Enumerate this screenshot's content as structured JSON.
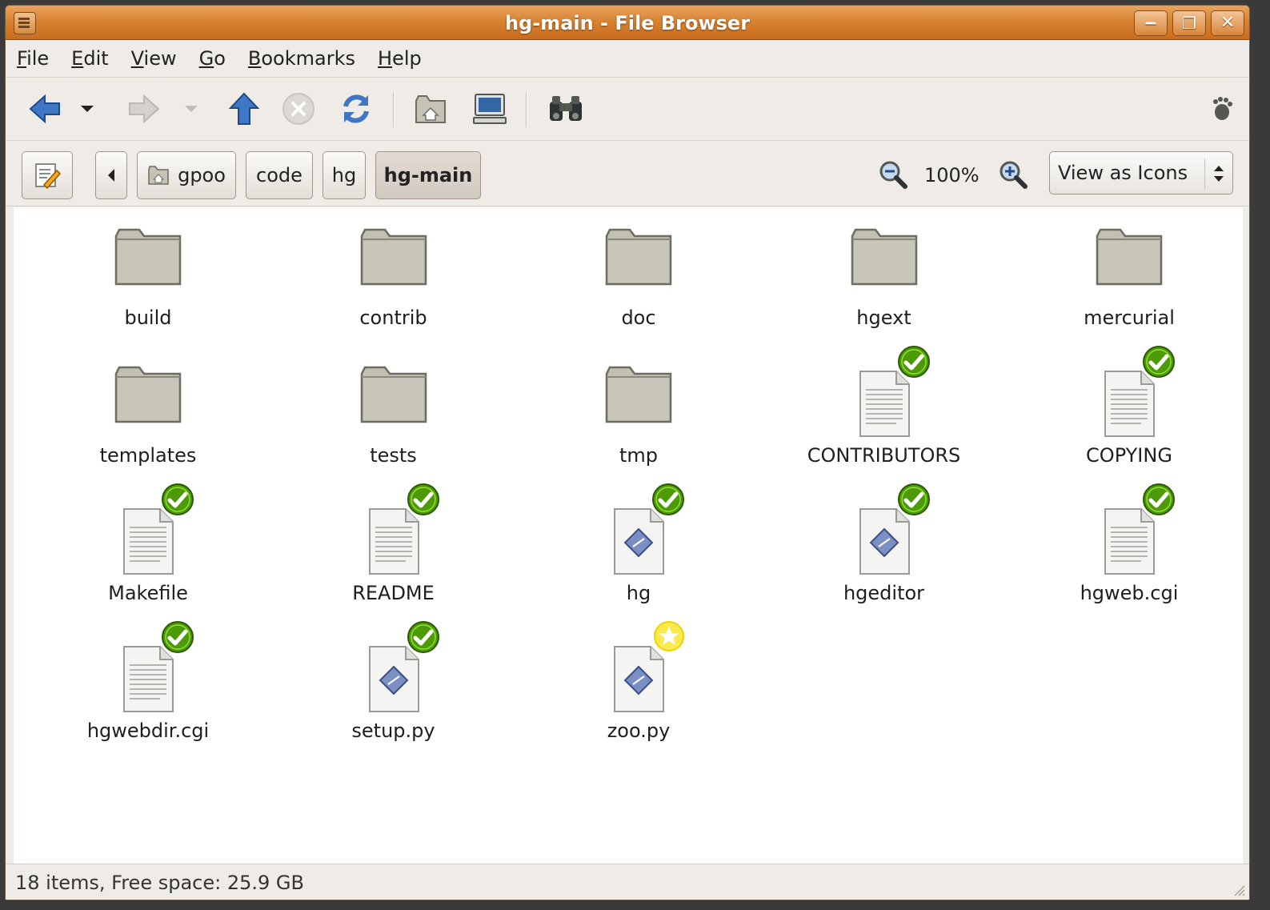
{
  "window": {
    "title": "hg-main - File Browser"
  },
  "menubar": {
    "items": [
      {
        "label": "File",
        "mnemonic": "F",
        "rest": "ile"
      },
      {
        "label": "Edit",
        "mnemonic": "E",
        "rest": "dit"
      },
      {
        "label": "View",
        "mnemonic": "V",
        "rest": "iew"
      },
      {
        "label": "Go",
        "mnemonic": "G",
        "rest": "o"
      },
      {
        "label": "Bookmarks",
        "mnemonic": "B",
        "rest": "ookmarks"
      },
      {
        "label": "Help",
        "mnemonic": "H",
        "rest": "elp"
      }
    ]
  },
  "toolbar": {
    "icons": [
      "back-icon",
      "back-history-icon",
      "forward-icon",
      "forward-history-icon",
      "up-icon",
      "stop-icon",
      "reload-icon",
      "home-icon",
      "computer-icon",
      "search-icon",
      "throbber-icon"
    ]
  },
  "location": {
    "path": [
      "gpoo",
      "code",
      "hg",
      "hg-main"
    ],
    "zoom": "100%",
    "view_mode": "View as Icons"
  },
  "files": [
    {
      "name": "build",
      "type": "folder",
      "emblem": ""
    },
    {
      "name": "contrib",
      "type": "folder",
      "emblem": ""
    },
    {
      "name": "doc",
      "type": "folder",
      "emblem": ""
    },
    {
      "name": "hgext",
      "type": "folder",
      "emblem": ""
    },
    {
      "name": "mercurial",
      "type": "folder",
      "emblem": ""
    },
    {
      "name": "templates",
      "type": "folder",
      "emblem": ""
    },
    {
      "name": "tests",
      "type": "folder",
      "emblem": ""
    },
    {
      "name": "tmp",
      "type": "folder",
      "emblem": ""
    },
    {
      "name": "CONTRIBUTORS",
      "type": "text",
      "emblem": "ok"
    },
    {
      "name": "COPYING",
      "type": "text",
      "emblem": "ok"
    },
    {
      "name": "Makefile",
      "type": "text",
      "emblem": "ok"
    },
    {
      "name": "README",
      "type": "text",
      "emblem": "ok"
    },
    {
      "name": "hg",
      "type": "script",
      "emblem": "ok"
    },
    {
      "name": "hgeditor",
      "type": "script",
      "emblem": "ok"
    },
    {
      "name": "hgweb.cgi",
      "type": "text",
      "emblem": "ok"
    },
    {
      "name": "hgwebdir.cgi",
      "type": "text",
      "emblem": "ok"
    },
    {
      "name": "setup.py",
      "type": "script",
      "emblem": "ok"
    },
    {
      "name": "zoo.py",
      "type": "script",
      "emblem": "new"
    }
  ],
  "statusbar": {
    "text": "18 items, Free space: 25.9 GB"
  },
  "colors": {
    "titlebar": "#d7802f",
    "folder": "#c5c3b6",
    "emblem_ok": "#4e9a06",
    "emblem_new": "#fce94f",
    "arrow_blue": "#3465a4"
  }
}
